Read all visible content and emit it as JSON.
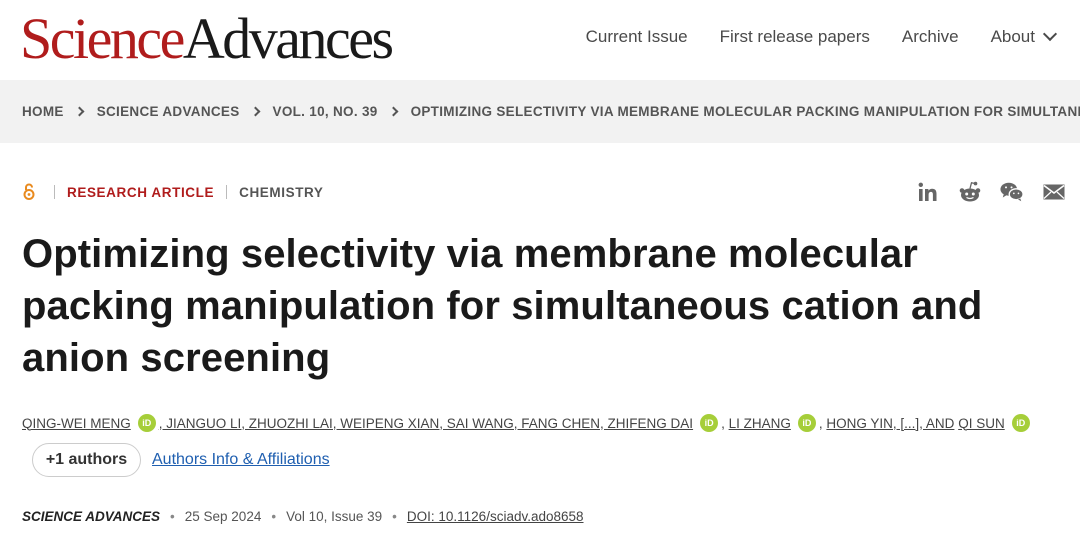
{
  "header": {
    "logo_science": "Science",
    "logo_advances": "Advances",
    "nav": [
      "Current Issue",
      "First release papers",
      "Archive",
      "About"
    ]
  },
  "breadcrumb": [
    "HOME",
    "SCIENCE ADVANCES",
    "VOL. 10, NO. 39",
    "OPTIMIZING SELECTIVITY VIA MEMBRANE MOLECULAR PACKING MANIPULATION FOR SIMULTANEOUS…"
  ],
  "article": {
    "type": "RESEARCH ARTICLE",
    "subject": "CHEMISTRY",
    "title": "Optimizing selectivity via membrane molecular packing manipulation for simultaneous cation and anion screening",
    "authors": {
      "a1": "QING-WEI MENG",
      "a2": ", JIANGUO LI, ZHUOZHI LAI, WEIPENG XIAN, SAI WANG, FANG CHEN, ZHIFENG DAI",
      "a3": "LI ZHANG",
      "a4": "HONG YIN, [...], AND",
      "a5": "QI SUN",
      "sep": ","
    },
    "more_authors": "+1 authors",
    "affiliations_link": "Authors Info & Affiliations",
    "journal": "SCIENCE ADVANCES",
    "date": "25 Sep 2024",
    "volume": "Vol 10, Issue 39",
    "doi": "DOI: 10.1126/sciadv.ado8658"
  },
  "share_icons": [
    "linkedin-icon",
    "reddit-icon",
    "wechat-icon",
    "email-icon"
  ],
  "colors": {
    "brand_red": "#b01c1c",
    "orcid_green": "#a6ce39",
    "link_blue": "#1f5fb0",
    "open_access_orange": "#e98a1e"
  }
}
